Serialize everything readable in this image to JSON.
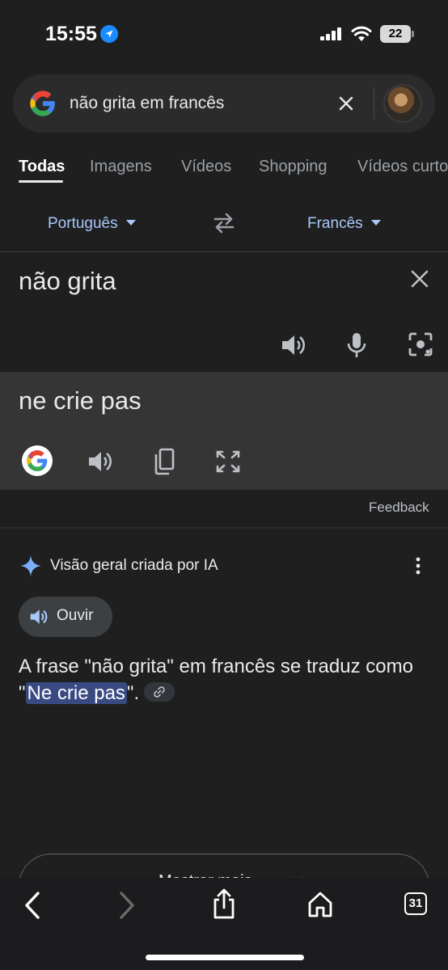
{
  "status_bar": {
    "time": "15:55",
    "battery": "22"
  },
  "search": {
    "query": "não grita em francês"
  },
  "tabs": [
    "Todas",
    "Imagens",
    "Vídeos",
    "Shopping",
    "Vídeos curtos"
  ],
  "translator": {
    "source_lang": "Português",
    "target_lang": "Francês",
    "source_text": "não grita",
    "translated_text": "ne crie pas",
    "feedback_label": "Feedback"
  },
  "ai_overview": {
    "title": "Visão geral criada por IA",
    "listen_label": "Ouvir",
    "answer_prefix": "A frase \"não grita\" em francês se traduz como \"",
    "answer_highlight": "Ne crie pas",
    "answer_suffix": "\".",
    "show_more_label": "Mostrar mais"
  },
  "browser": {
    "tab_count": "31"
  },
  "colors": {
    "accent_blue": "#a8c7fa",
    "highlight": "#394a83",
    "background": "#1f1f1f",
    "target_panel": "#353535"
  }
}
